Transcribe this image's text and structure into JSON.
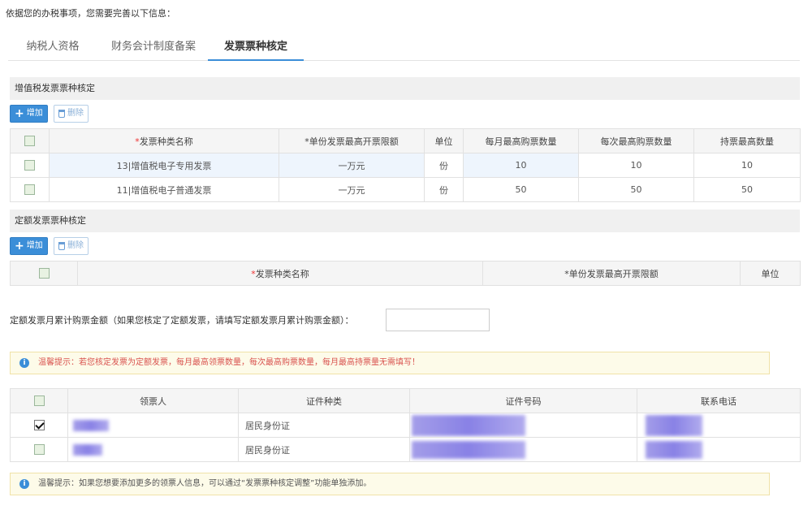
{
  "intro": "依据您的办税事项，您需要完善以下信息：",
  "tabs": [
    {
      "label": "纳税人资格",
      "active": false
    },
    {
      "label": "财务会计制度备案",
      "active": false
    },
    {
      "label": "发票票种核定",
      "active": true
    }
  ],
  "vat_section": {
    "title": "增值税发票票种核定",
    "add_label": "增加",
    "delete_label": "删除",
    "columns": [
      "*发票种类名称",
      "*单份发票最高开票限额",
      "单位",
      "每月最高购票数量",
      "每次最高购票数量",
      "持票最高数量"
    ],
    "rows": [
      [
        "13|增值税电子专用发票",
        "一万元",
        "份",
        "10",
        "10",
        "10"
      ],
      [
        "11|增值税电子普通发票",
        "一万元",
        "份",
        "50",
        "50",
        "50"
      ]
    ]
  },
  "fixed_section": {
    "title": "定额发票票种核定",
    "add_label": "增加",
    "delete_label": "删除",
    "columns": [
      "*发票种类名称",
      "*单份发票最高开票限额",
      "单位"
    ]
  },
  "monthly_total": {
    "label": "定额发票月累计购票金额（如果您核定了定额发票，请填写定额发票月累计购票金额）：",
    "value": ""
  },
  "tip1": "温馨提示：若您核定发票为定额发票，每月最高领票数量，每次最高购票数量，每月最高持票量无需填写！",
  "recipients": {
    "columns": [
      "领票人",
      "证件种类",
      "证件号码",
      "联系电话"
    ],
    "rows": [
      {
        "checked": true,
        "id_type": "居民身份证"
      },
      {
        "checked": false,
        "id_type": "居民身份证"
      }
    ]
  },
  "tip2": "温馨提示：如果您想要添加更多的领票人信息，可以通过“发票票种核定调整”功能单独添加。",
  "colors": {
    "accent": "#3b8ed8",
    "warning_text": "#d9534f",
    "tip_bg": "#fdfbe9"
  }
}
